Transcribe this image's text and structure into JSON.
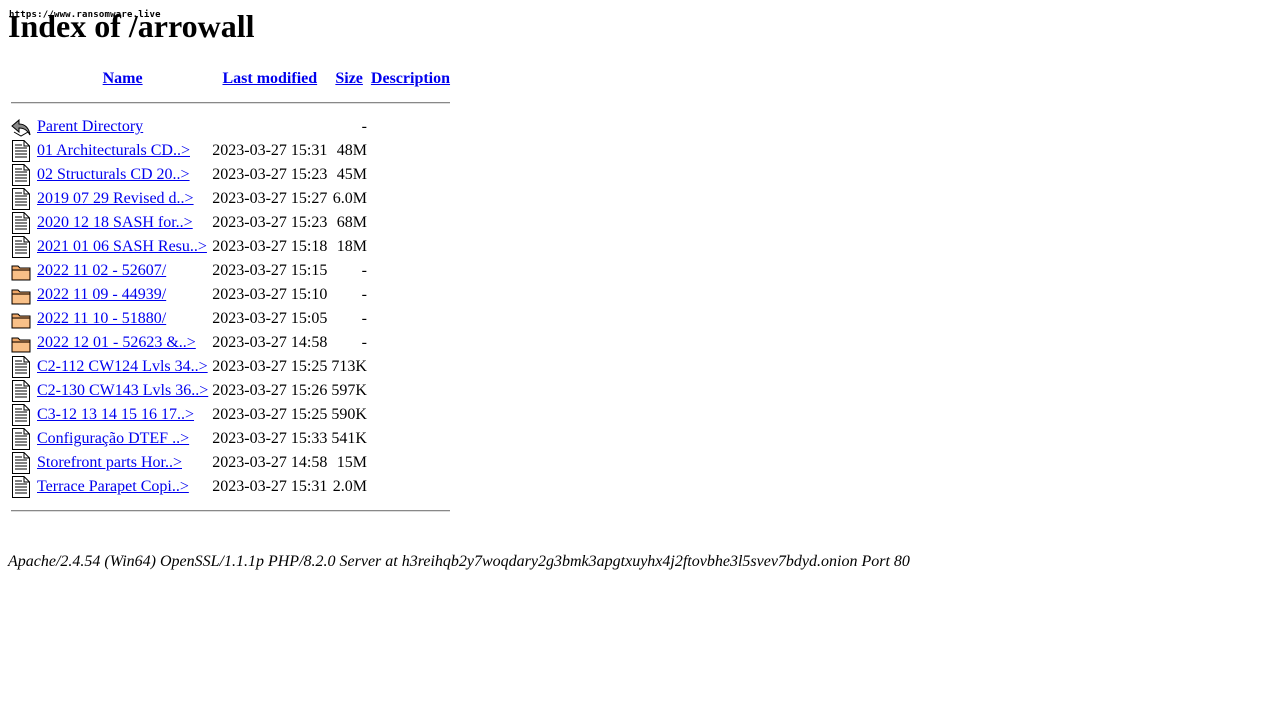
{
  "watermark": "https://www.ransomware.live",
  "page_title": "Index of /arrowall",
  "columns": {
    "name": "Name",
    "last_modified": "Last modified",
    "size": "Size",
    "description": "Description"
  },
  "rows": [
    {
      "icon": "back-icon",
      "name": "Parent Directory",
      "modified": "",
      "size": "-"
    },
    {
      "icon": "text-file-icon",
      "name": "01 Architecturals CD..>",
      "modified": "2023-03-27 15:31",
      "size": "48M"
    },
    {
      "icon": "text-file-icon",
      "name": "02 Structurals CD 20..>",
      "modified": "2023-03-27 15:23",
      "size": "45M"
    },
    {
      "icon": "text-file-icon",
      "name": "2019 07 29 Revised d..>",
      "modified": "2023-03-27 15:27",
      "size": "6.0M"
    },
    {
      "icon": "text-file-icon",
      "name": "2020 12 18 SASH for..>",
      "modified": "2023-03-27 15:23",
      "size": "68M"
    },
    {
      "icon": "text-file-icon",
      "name": "2021 01 06 SASH Resu..>",
      "modified": "2023-03-27 15:18",
      "size": "18M"
    },
    {
      "icon": "folder-icon",
      "name": "2022 11 02 - 52607/",
      "modified": "2023-03-27 15:15",
      "size": "-"
    },
    {
      "icon": "folder-icon",
      "name": "2022 11 09 - 44939/",
      "modified": "2023-03-27 15:10",
      "size": "-"
    },
    {
      "icon": "folder-icon",
      "name": "2022 11 10 - 51880/",
      "modified": "2023-03-27 15:05",
      "size": "-"
    },
    {
      "icon": "folder-icon",
      "name": "2022 12 01 - 52623 &..>",
      "modified": "2023-03-27 14:58",
      "size": "-"
    },
    {
      "icon": "text-file-icon",
      "name": "C2-112 CW124 Lvls 34..>",
      "modified": "2023-03-27 15:25",
      "size": "713K"
    },
    {
      "icon": "text-file-icon",
      "name": "C2-130 CW143 Lvls 36..>",
      "modified": "2023-03-27 15:26",
      "size": "597K"
    },
    {
      "icon": "text-file-icon",
      "name": "C3-12 13 14 15 16 17..>",
      "modified": "2023-03-27 15:25",
      "size": "590K"
    },
    {
      "icon": "text-file-icon",
      "name": "Configuração  DTEF  ..>",
      "modified": "2023-03-27 15:33",
      "size": "541K"
    },
    {
      "icon": "text-file-icon",
      "name": "Storefront parts Hor..>",
      "modified": "2023-03-27 14:58",
      "size": "15M"
    },
    {
      "icon": "text-file-icon",
      "name": "Terrace Parapet Copi..>",
      "modified": "2023-03-27 15:31",
      "size": "2.0M"
    }
  ],
  "server_signature": "Apache/2.4.54 (Win64) OpenSSL/1.1.1p PHP/8.2.0 Server at h3reihqb2y7woqdary2g3bmk3apgtxuyhx4j2ftovbhe3l5svev7bdyd.onion Port 80"
}
